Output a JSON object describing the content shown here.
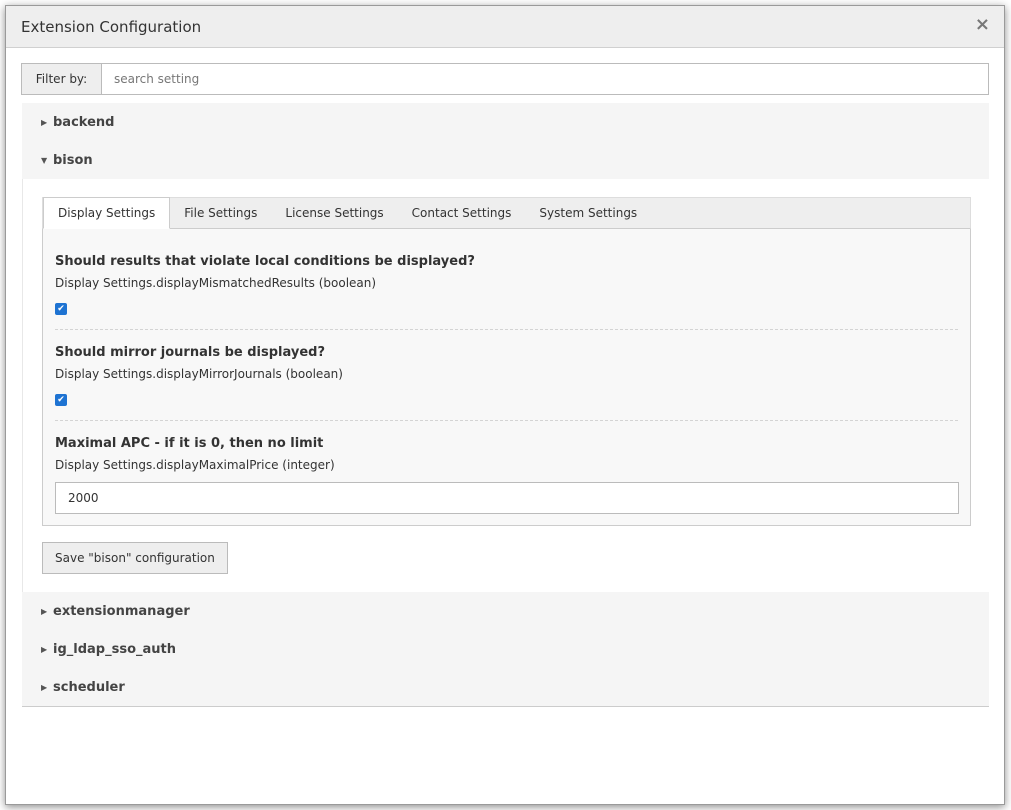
{
  "modal": {
    "title": "Extension Configuration",
    "close_glyph": "×"
  },
  "filter": {
    "label": "Filter by:",
    "placeholder": "search setting",
    "value": ""
  },
  "extensions": {
    "backend": {
      "name": "backend",
      "expanded": false
    },
    "bison": {
      "name": "bison",
      "expanded": true
    },
    "extensionmanager": {
      "name": "extensionmanager",
      "expanded": false
    },
    "ig_ldap_sso_auth": {
      "name": "ig_ldap_sso_auth",
      "expanded": false
    },
    "scheduler": {
      "name": "scheduler",
      "expanded": false
    }
  },
  "tabs": [
    {
      "label": "Display Settings",
      "active": true
    },
    {
      "label": "File Settings",
      "active": false
    },
    {
      "label": "License Settings",
      "active": false
    },
    {
      "label": "Contact Settings",
      "active": false
    },
    {
      "label": "System Settings",
      "active": false
    }
  ],
  "settings": [
    {
      "title": "Should results that violate local conditions be displayed?",
      "key": "Display Settings.displayMismatchedResults (boolean)",
      "type": "checkbox",
      "checked": true
    },
    {
      "title": "Should mirror journals be displayed?",
      "key": "Display Settings.displayMirrorJournals (boolean)",
      "type": "checkbox",
      "checked": true
    },
    {
      "title": "Maximal APC - if it is 0, then no limit",
      "key": "Display Settings.displayMaximalPrice (integer)",
      "type": "integer",
      "value": "2000"
    }
  ],
  "save_button": "Save \"bison\" configuration",
  "icons": {
    "caret_right": "▶",
    "caret_down": "▼",
    "check": "✔"
  },
  "colors": {
    "checkbox": "#1e73d2",
    "panel_head_bg": "#f5f5f5",
    "header_bg": "#eeeeee"
  }
}
